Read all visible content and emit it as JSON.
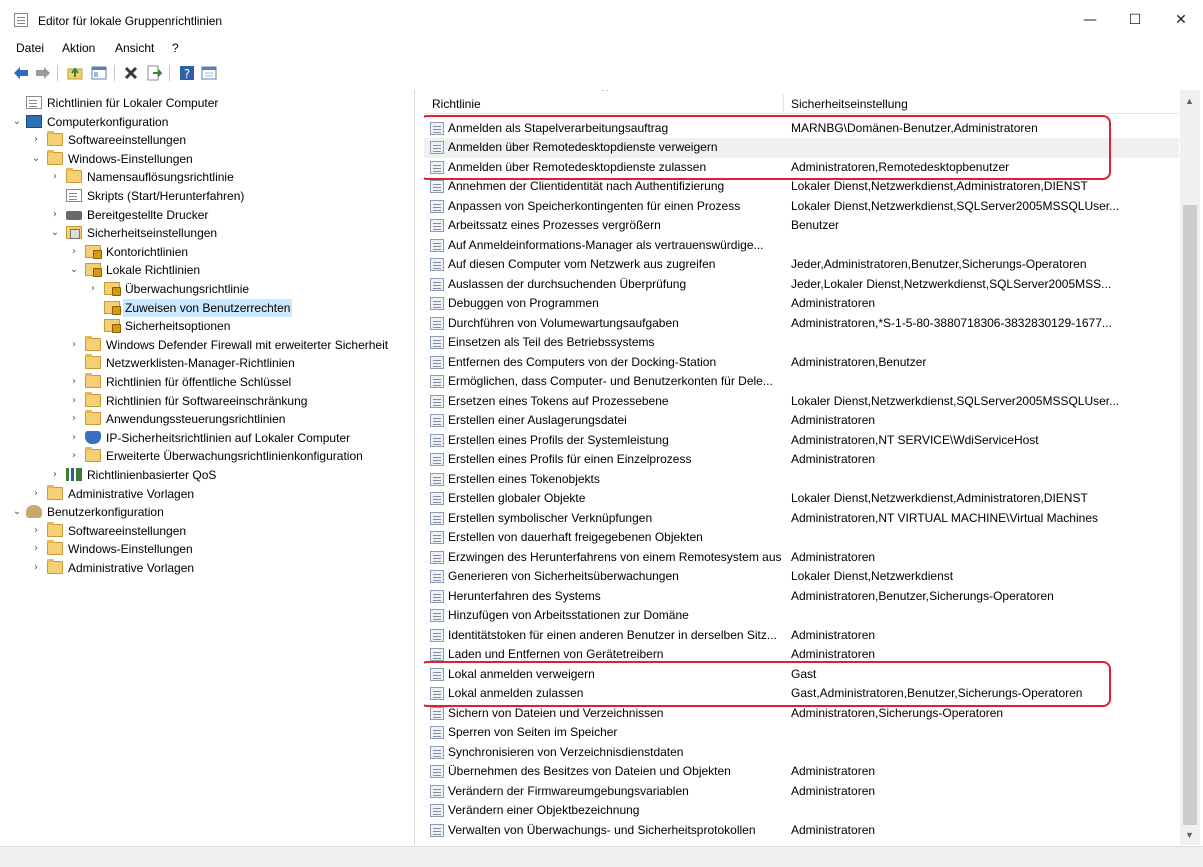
{
  "window": {
    "title": "Editor für lokale Gruppenrichtlinien",
    "controls": {
      "minimize": "—",
      "maximize": "☐",
      "close": "✕"
    }
  },
  "menu": [
    "Datei",
    "Aktion",
    "Ansicht",
    "?"
  ],
  "toolbar": {
    "icons": [
      "back-arrow-icon",
      "forward-arrow-icon",
      "up-folder-icon",
      "show-hide-tree-icon",
      "delete-icon",
      "export-list-icon",
      "help-icon",
      "properties-icon"
    ]
  },
  "tree": [
    {
      "label": "Richtlinien für Lokaler Computer",
      "level": 0,
      "icon": "policy-doc-icon",
      "expander": ""
    },
    {
      "label": "Computerkonfiguration",
      "level": 0,
      "icon": "computer-icon",
      "expander": "⌄"
    },
    {
      "label": "Softwareeinstellungen",
      "level": 1,
      "icon": "folder-icon",
      "expander": "›"
    },
    {
      "label": "Windows-Einstellungen",
      "level": 1,
      "icon": "folder-icon",
      "expander": "⌄"
    },
    {
      "label": "Namensauflösungsrichtlinie",
      "level": 2,
      "icon": "folder-icon",
      "expander": "›"
    },
    {
      "label": "Skripts (Start/Herunterfahren)",
      "level": 2,
      "icon": "document-icon",
      "expander": ""
    },
    {
      "label": "Bereitgestellte Drucker",
      "level": 2,
      "icon": "printer-icon",
      "expander": "›"
    },
    {
      "label": "Sicherheitseinstellungen",
      "level": 2,
      "icon": "security-folder-icon",
      "expander": "⌄"
    },
    {
      "label": "Kontorichtlinien",
      "level": 3,
      "icon": "lock-folder-icon",
      "expander": "›"
    },
    {
      "label": "Lokale Richtlinien",
      "level": 3,
      "icon": "lock-folder-icon",
      "expander": "⌄"
    },
    {
      "label": "Überwachungsrichtlinie",
      "level": 4,
      "icon": "lock-folder-icon",
      "expander": "›"
    },
    {
      "label": "Zuweisen von Benutzerrechten",
      "level": 4,
      "icon": "lock-folder-icon",
      "expander": "",
      "selected": true
    },
    {
      "label": "Sicherheitsoptionen",
      "level": 4,
      "icon": "lock-folder-icon",
      "expander": ""
    },
    {
      "label": "Windows Defender Firewall mit erweiterter Sicherheit",
      "level": 3,
      "icon": "folder-icon",
      "expander": "›"
    },
    {
      "label": "Netzwerklisten-Manager-Richtlinien",
      "level": 3,
      "icon": "folder-icon",
      "expander": ""
    },
    {
      "label": "Richtlinien für öffentliche Schlüssel",
      "level": 3,
      "icon": "folder-icon",
      "expander": "›"
    },
    {
      "label": "Richtlinien für Softwareeinschränkung",
      "level": 3,
      "icon": "folder-icon",
      "expander": "›"
    },
    {
      "label": "Anwendungssteuerungsrichtlinien",
      "level": 3,
      "icon": "folder-icon",
      "expander": "›"
    },
    {
      "label": "IP-Sicherheitsrichtlinien auf Lokaler Computer",
      "level": 3,
      "icon": "ip-security-icon",
      "expander": "›"
    },
    {
      "label": "Erweiterte Überwachungsrichtlinienkonfiguration",
      "level": 3,
      "icon": "folder-icon",
      "expander": "›"
    },
    {
      "label": "Richtlinienbasierter QoS",
      "level": 2,
      "icon": "qos-chart-icon",
      "expander": "›"
    },
    {
      "label": "Administrative Vorlagen",
      "level": 1,
      "icon": "folder-icon",
      "expander": "›"
    },
    {
      "label": "Benutzerkonfiguration",
      "level": 0,
      "icon": "user-icon",
      "expander": "⌄"
    },
    {
      "label": "Softwareeinstellungen",
      "level": 1,
      "icon": "folder-icon",
      "expander": "›"
    },
    {
      "label": "Windows-Einstellungen",
      "level": 1,
      "icon": "folder-icon",
      "expander": "›"
    },
    {
      "label": "Administrative Vorlagen",
      "level": 1,
      "icon": "folder-icon",
      "expander": "›"
    }
  ],
  "list": {
    "columns": [
      "Richtlinie",
      "Sicherheitseinstellung"
    ],
    "rows": [
      {
        "policy": "Anmelden als Stapelverarbeitungsauftrag",
        "setting": "MARNBG\\Domänen-Benutzer,Administratoren"
      },
      {
        "policy": "Anmelden über Remotedesktopdienste verweigern",
        "setting": "",
        "highlighted": true
      },
      {
        "policy": "Anmelden über Remotedesktopdienste zulassen",
        "setting": "Administratoren,Remotedesktopbenutzer"
      },
      {
        "policy": "Annehmen der Clientidentität nach Authentifizierung",
        "setting": "Lokaler Dienst,Netzwerkdienst,Administratoren,DIENST"
      },
      {
        "policy": "Anpassen von Speicherkontingenten für einen Prozess",
        "setting": "Lokaler Dienst,Netzwerkdienst,SQLServer2005MSSQLUser..."
      },
      {
        "policy": "Arbeitssatz eines Prozesses vergrößern",
        "setting": "Benutzer"
      },
      {
        "policy": "Auf Anmeldeinformations-Manager als vertrauenswürdige...",
        "setting": ""
      },
      {
        "policy": "Auf diesen Computer vom Netzwerk aus zugreifen",
        "setting": "Jeder,Administratoren,Benutzer,Sicherungs-Operatoren"
      },
      {
        "policy": "Auslassen der durchsuchenden Überprüfung",
        "setting": "Jeder,Lokaler Dienst,Netzwerkdienst,SQLServer2005MSS..."
      },
      {
        "policy": "Debuggen von Programmen",
        "setting": "Administratoren"
      },
      {
        "policy": "Durchführen von Volumewartungsaufgaben",
        "setting": "Administratoren,*S-1-5-80-3880718306-3832830129-1677..."
      },
      {
        "policy": "Einsetzen als Teil des Betriebssystems",
        "setting": ""
      },
      {
        "policy": "Entfernen des Computers von der Docking-Station",
        "setting": "Administratoren,Benutzer"
      },
      {
        "policy": "Ermöglichen, dass Computer- und Benutzerkonten für Dele...",
        "setting": ""
      },
      {
        "policy": "Ersetzen eines Tokens auf Prozessebene",
        "setting": "Lokaler Dienst,Netzwerkdienst,SQLServer2005MSSQLUser..."
      },
      {
        "policy": "Erstellen einer Auslagerungsdatei",
        "setting": "Administratoren"
      },
      {
        "policy": "Erstellen eines Profils der Systemleistung",
        "setting": "Administratoren,NT SERVICE\\WdiServiceHost"
      },
      {
        "policy": "Erstellen eines Profils für einen Einzelprozess",
        "setting": "Administratoren"
      },
      {
        "policy": "Erstellen eines Tokenobjekts",
        "setting": ""
      },
      {
        "policy": "Erstellen globaler Objekte",
        "setting": "Lokaler Dienst,Netzwerkdienst,Administratoren,DIENST"
      },
      {
        "policy": "Erstellen symbolischer Verknüpfungen",
        "setting": "Administratoren,NT VIRTUAL MACHINE\\Virtual Machines"
      },
      {
        "policy": "Erstellen von dauerhaft freigegebenen Objekten",
        "setting": ""
      },
      {
        "policy": "Erzwingen des Herunterfahrens von einem Remotesystem aus",
        "setting": "Administratoren"
      },
      {
        "policy": "Generieren von Sicherheitsüberwachungen",
        "setting": "Lokaler Dienst,Netzwerkdienst"
      },
      {
        "policy": "Herunterfahren des Systems",
        "setting": "Administratoren,Benutzer,Sicherungs-Operatoren"
      },
      {
        "policy": "Hinzufügen von Arbeitsstationen zur Domäne",
        "setting": ""
      },
      {
        "policy": "Identitätstoken für einen anderen Benutzer in derselben Sitz...",
        "setting": "Administratoren"
      },
      {
        "policy": "Laden und Entfernen von Gerätetreibern",
        "setting": "Administratoren"
      },
      {
        "policy": "Lokal anmelden verweigern",
        "setting": "Gast"
      },
      {
        "policy": "Lokal anmelden zulassen",
        "setting": "Gast,Administratoren,Benutzer,Sicherungs-Operatoren"
      },
      {
        "policy": "Sichern von Dateien und Verzeichnissen",
        "setting": "Administratoren,Sicherungs-Operatoren"
      },
      {
        "policy": "Sperren von Seiten im Speicher",
        "setting": ""
      },
      {
        "policy": "Synchronisieren von Verzeichnisdienstdaten",
        "setting": ""
      },
      {
        "policy": "Übernehmen des Besitzes von Dateien und Objekten",
        "setting": "Administratoren"
      },
      {
        "policy": "Verändern der Firmwareumgebungsvariablen",
        "setting": "Administratoren"
      },
      {
        "policy": "Verändern einer Objektbezeichnung",
        "setting": ""
      },
      {
        "policy": "Verwalten von Überwachungs- und Sicherheitsprotokollen",
        "setting": "Administratoren"
      }
    ]
  },
  "annotations": {
    "color": "#e0202e",
    "boxes": [
      {
        "rows": [
          0,
          2
        ]
      },
      {
        "rows": [
          28,
          29
        ]
      }
    ]
  }
}
